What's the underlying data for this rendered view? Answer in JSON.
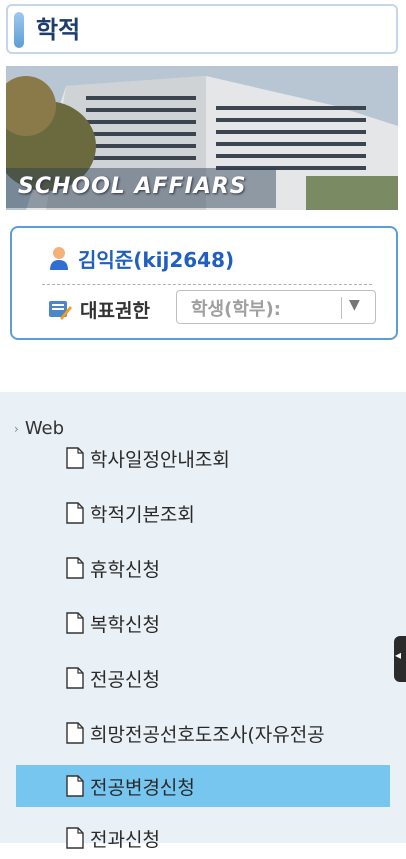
{
  "header": {
    "title": "학적"
  },
  "banner": {
    "caption": "SCHOOL AFFIARS"
  },
  "user": {
    "name": "김익준(kij2648)",
    "role_label": "대표권한",
    "role_value": "학생(학부):",
    "role_arrow": "▼"
  },
  "menu": {
    "group_label": "Web",
    "items": [
      {
        "label": "학사일정안내조회"
      },
      {
        "label": "학적기본조회"
      },
      {
        "label": "휴학신청"
      },
      {
        "label": "복학신청"
      },
      {
        "label": "전공신청"
      },
      {
        "label": "희망전공선호도조사(자유전공"
      },
      {
        "label": "전공변경신청"
      },
      {
        "label": "전과신청"
      }
    ],
    "selected_index": 6,
    "selected_color": "#77c6f0"
  }
}
